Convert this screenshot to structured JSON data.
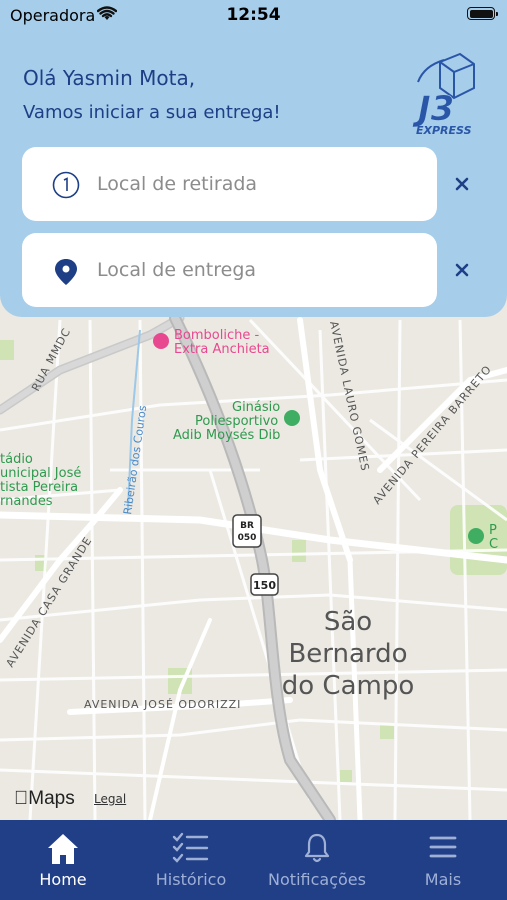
{
  "status_bar": {
    "carrier": "Operadora",
    "time": "12:54"
  },
  "header": {
    "greeting": "Olá Yasmin Mota,",
    "subtitle": "Vamos iniciar a sua entrega!",
    "logo_text": "EXPRESS",
    "logo_mark": "J3"
  },
  "fields": {
    "pickup": {
      "placeholder": "Local de retirada",
      "icon": "number-one-circle-icon"
    },
    "dropoff": {
      "placeholder": "Local de entrega",
      "icon": "location-pin-icon"
    }
  },
  "map": {
    "labels": {
      "city_line1": "São",
      "city_line2": "Bernardo",
      "city_line3": "do Campo",
      "poi_store_1": "Bomboliche -",
      "poi_store_2": "Extra Anchieta",
      "poi_gym_1": "Ginásio",
      "poi_gym_2": "Poliesportivo",
      "poi_gym_3": "Adib Moysés Dib",
      "poi_stadium_1": "tádio",
      "poi_stadium_2": "unicipal José",
      "poi_stadium_3": "tista Pereira",
      "poi_stadium_4": "rnandes",
      "road_rua_mmdc": "RUA MMDC",
      "road_ribeirao": "Ribeirão dos Couros",
      "road_lauro": "AVENIDA LAURO GOMES",
      "road_pereira": "AVENIDA PEREIRA BARRETO",
      "road_casa_grande": "AVENIDA CASA GRANDE",
      "road_odorizzi": "AVENIDA JOSÉ ODORIZZI",
      "shield_br_1": "BR",
      "shield_br_2": "050",
      "shield_150": "150",
      "park_p_1": "P",
      "park_p_2": "C",
      "park_p_3": "o"
    },
    "attribution": "Maps",
    "legal": "Legal"
  },
  "tabbar": {
    "tabs": [
      {
        "label": "Home",
        "icon": "home-icon",
        "active": true
      },
      {
        "label": "Histórico",
        "icon": "checklist-icon",
        "active": false
      },
      {
        "label": "Notificações",
        "icon": "bell-icon",
        "active": false
      },
      {
        "label": "Mais",
        "icon": "menu-icon",
        "active": false
      }
    ]
  },
  "colors": {
    "header_bg": "#a6cdea",
    "primary": "#1e3f86",
    "tabbar_bg": "#213f87",
    "map_bg": "#eceae3"
  }
}
